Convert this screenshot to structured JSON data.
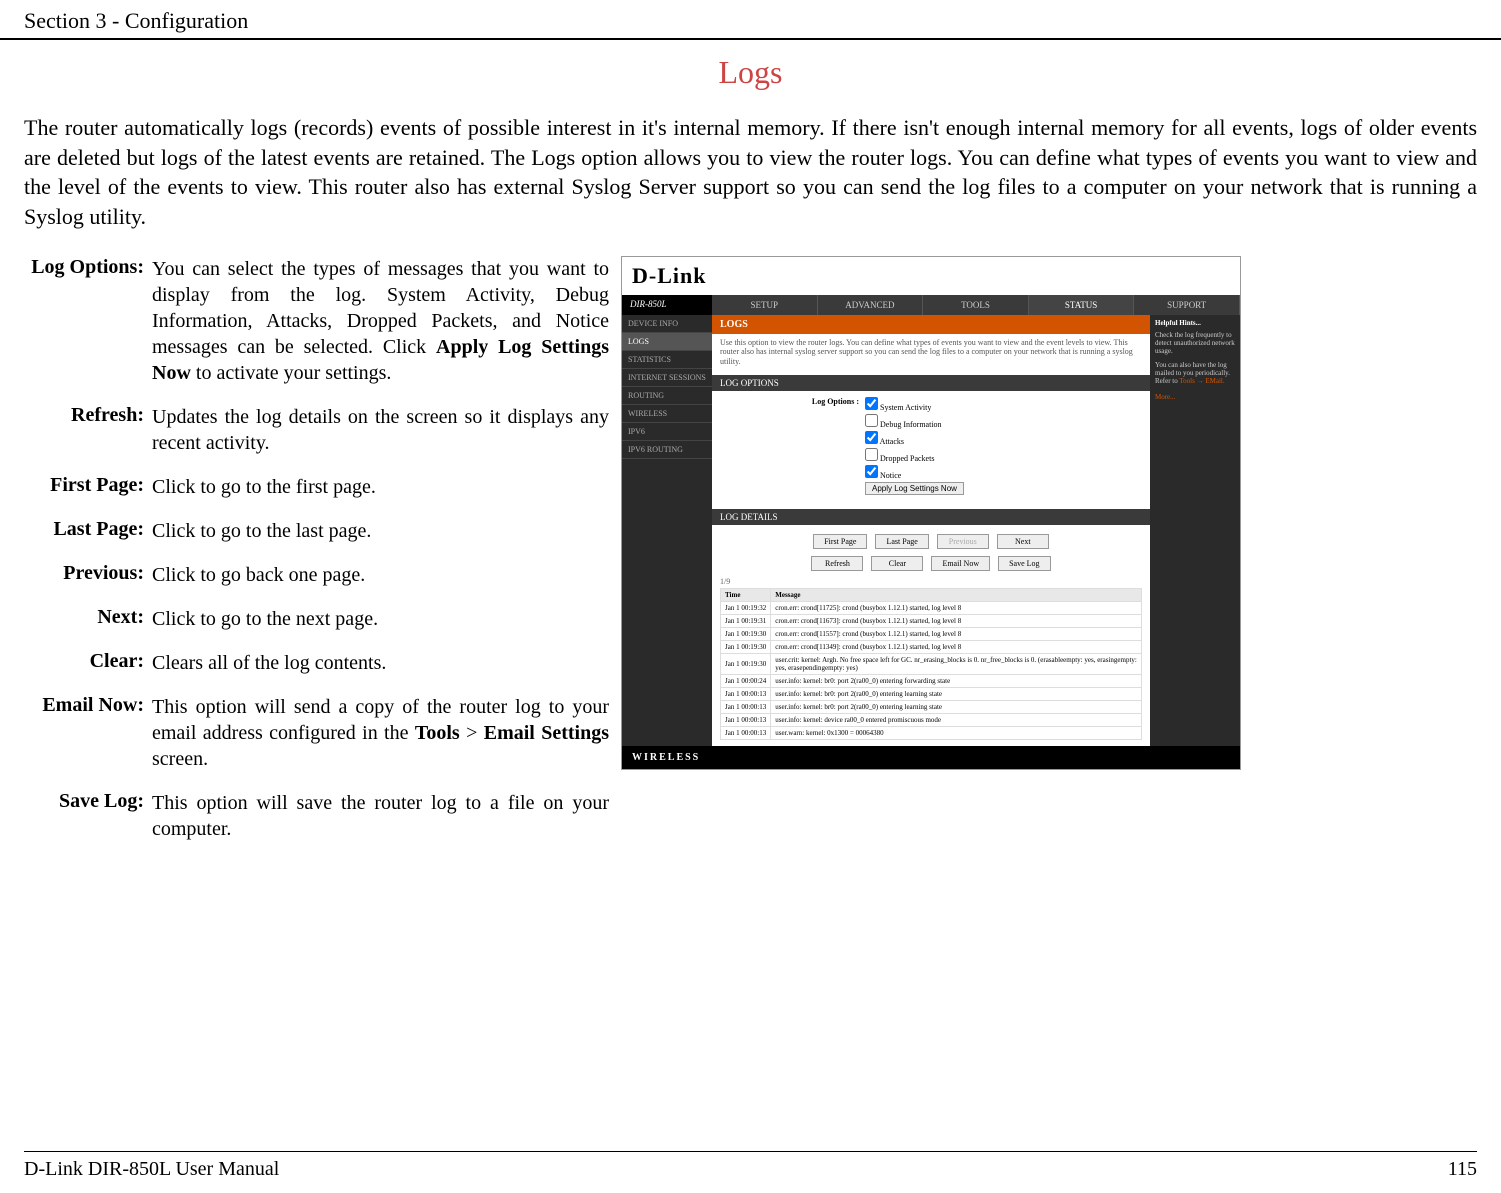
{
  "header": {
    "section": "Section 3 - Configuration"
  },
  "title": "Logs",
  "intro": "The router automatically logs (records) events of possible interest in it's internal memory. If there isn't enough internal memory for all events, logs of older events are deleted but logs of the latest events are retained. The Logs option allows you to view the router logs. You can define what types of events you want to view and the level of the events to view. This router also has external Syslog Server support so you can send the log files to a computer on your network that is running a Syslog utility.",
  "definitions": [
    {
      "label": "Log Options:",
      "desc_parts": [
        "You can select the types of messages that you want to display from the log. System Activity, Debug Information, Attacks, Dropped Packets, and Notice messages can be selected. Click ",
        "Apply Log Settings Now",
        " to activate your settings."
      ]
    },
    {
      "label": "Refresh:",
      "desc": "Updates the log details on the screen so it displays any recent activity."
    },
    {
      "label": "First Page:",
      "desc": "Click to go to the first page."
    },
    {
      "label": "Last Page:",
      "desc": "Click to go to the last page."
    },
    {
      "label": "Previous:",
      "desc": "Click to go back one page."
    },
    {
      "label": "Next:",
      "desc": "Click to go to the next page."
    },
    {
      "label": "Clear:",
      "desc": "Clears all of the log contents."
    },
    {
      "label": "Email Now:",
      "desc_parts": [
        "This option will send a copy of the router log to your email address configured in the ",
        "Tools",
        " > ",
        "Email Settings",
        " screen."
      ]
    },
    {
      "label": "Save Log:",
      "desc": "This option will save the router log to a file on your computer."
    }
  ],
  "screenshot": {
    "logo": "D-Link",
    "model": "DIR-850L",
    "tabs": [
      "SETUP",
      "ADVANCED",
      "TOOLS",
      "STATUS",
      "SUPPORT"
    ],
    "active_tab": 3,
    "sidebar": [
      "DEVICE INFO",
      "LOGS",
      "STATISTICS",
      "INTERNET SESSIONS",
      "ROUTING",
      "WIRELESS",
      "IPV6",
      "IPV6 ROUTING"
    ],
    "active_sidebar": 1,
    "logs_header": "LOGS",
    "logs_desc": "Use this option to view the router logs. You can define what types of events you want to view and the event levels to view. This router also has internal syslog server support so you can send the log files to a computer on your network that is running a syslog utility.",
    "log_options_header": "LOG OPTIONS",
    "log_options_label": "Log Options :",
    "log_options": [
      {
        "label": "System Activity",
        "checked": true
      },
      {
        "label": "Debug Information",
        "checked": false
      },
      {
        "label": "Attacks",
        "checked": true
      },
      {
        "label": "Dropped Packets",
        "checked": false
      },
      {
        "label": "Notice",
        "checked": true
      }
    ],
    "apply_btn": "Apply Log Settings Now",
    "log_details_header": "LOG DETAILS",
    "buttons_row1": [
      "First Page",
      "Last Page",
      "Previous",
      "Next"
    ],
    "buttons_row2": [
      "Refresh",
      "Clear",
      "Email Now",
      "Save Log"
    ],
    "page_info": "1/9",
    "table_headers": [
      "Time",
      "Message"
    ],
    "table_rows": [
      [
        "Jan 1 00:19:32",
        "cron.err: crond[11725]: crond (busybox 1.12.1) started, log level 8"
      ],
      [
        "Jan 1 00:19:31",
        "cron.err: crond[11673]: crond (busybox 1.12.1) started, log level 8"
      ],
      [
        "Jan 1 00:19:30",
        "cron.err: crond[11557]: crond (busybox 1.12.1) started, log level 8"
      ],
      [
        "Jan 1 00:19:30",
        "cron.err: crond[11349]: crond (busybox 1.12.1) started, log level 8"
      ],
      [
        "Jan 1 00:19:30",
        "user.crit: kernel: Argh. No free space left for GC. nr_erasing_blocks is 0. nr_free_blocks is 0. (erasableempty: yes, erasingempty: yes, erasependingempty: yes)"
      ],
      [
        "Jan 1 00:00:24",
        "user.info: kernel: br0: port 2(ra00_0) entering forwarding state"
      ],
      [
        "Jan 1 00:00:13",
        "user.info: kernel: br0: port 2(ra00_0) entering learning state"
      ],
      [
        "Jan 1 00:00:13",
        "user.info: kernel: br0: port 2(ra00_0) entering learning state"
      ],
      [
        "Jan 1 00:00:13",
        "user.info: kernel: device ra00_0 entered promiscuous mode"
      ],
      [
        "Jan 1 00:00:13",
        "user.warn: kernel: 0x1300 = 00064380"
      ]
    ],
    "hints_title": "Helpful Hints...",
    "hints_p1": "Check the log frequently to detect unauthorized network usage.",
    "hints_p2": "You can also have the log mailed to you periodically. Refer to ",
    "hints_link": "Tools → EMail.",
    "hints_more": "More...",
    "footer_brand": "WIRELESS"
  },
  "footer": {
    "manual": "D-Link DIR-850L User Manual",
    "page": "115"
  }
}
